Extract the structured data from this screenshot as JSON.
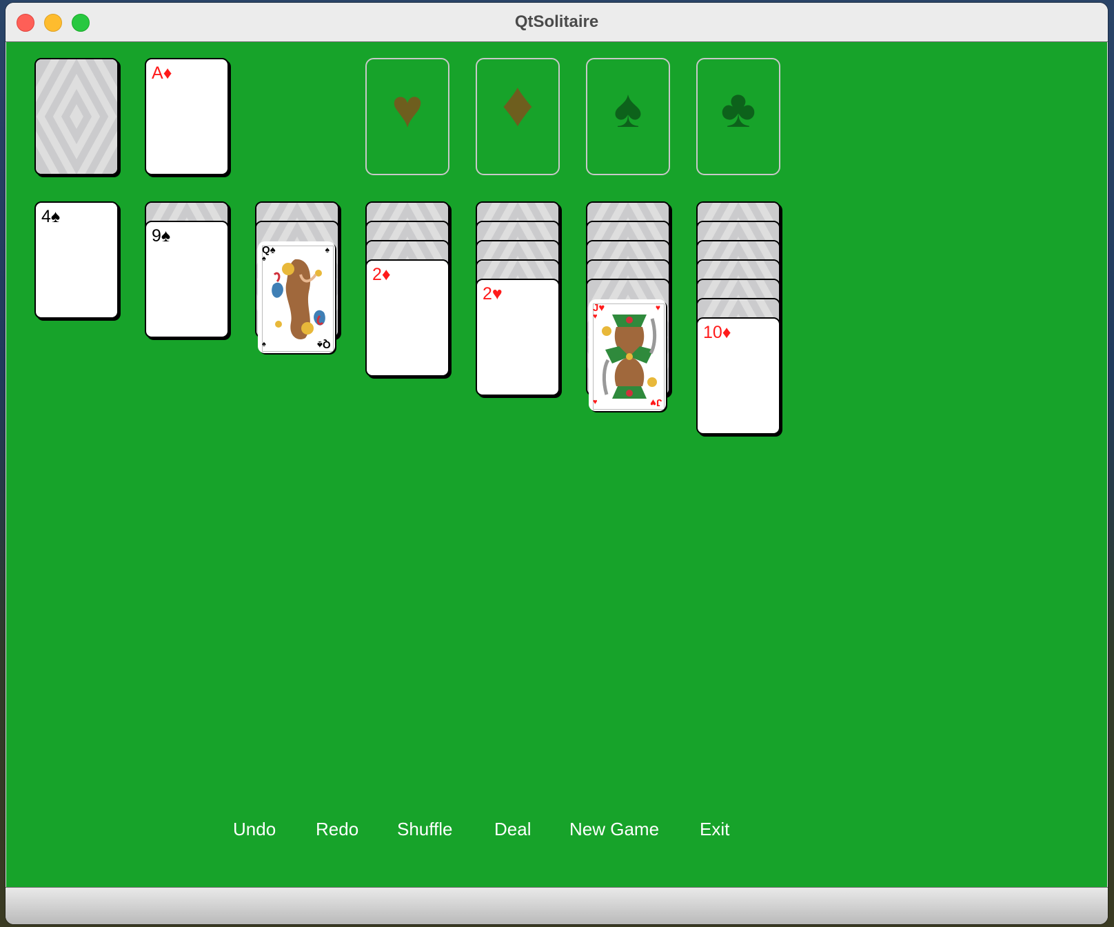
{
  "window": {
    "title": "QtSolitaire"
  },
  "colors": {
    "felt": "#17a32a",
    "red_suit": "#ff1a1a",
    "foundation_red_suit": "#6e5e1e",
    "foundation_black_suit": "#0d621b"
  },
  "stock": {
    "face_down": true
  },
  "waste": {
    "top_card": {
      "rank": "A",
      "suit": "♦",
      "color": "red"
    }
  },
  "foundations": [
    {
      "suit_name": "hearts",
      "symbol": "♥",
      "empty": true
    },
    {
      "suit_name": "diamonds",
      "symbol": "♦",
      "empty": true
    },
    {
      "suit_name": "spades",
      "symbol": "♠",
      "empty": true
    },
    {
      "suit_name": "clubs",
      "symbol": "♣",
      "empty": true
    }
  ],
  "tableau": [
    {
      "face_down": 0,
      "face_up": [
        {
          "rank": "4",
          "suit": "♠",
          "label": "4♠",
          "color": "black"
        }
      ]
    },
    {
      "face_down": 1,
      "face_up": [
        {
          "rank": "9",
          "suit": "♠",
          "label": "9♠",
          "color": "black"
        }
      ]
    },
    {
      "face_down": 2,
      "face_up": [
        {
          "rank": "Q",
          "suit": "♠",
          "label": "Q♠",
          "color": "black",
          "court": "queen"
        }
      ]
    },
    {
      "face_down": 3,
      "face_up": [
        {
          "rank": "2",
          "suit": "♦",
          "label": "2♦",
          "color": "red"
        }
      ]
    },
    {
      "face_down": 4,
      "face_up": [
        {
          "rank": "2",
          "suit": "♥",
          "label": "2♥",
          "color": "red"
        }
      ]
    },
    {
      "face_down": 5,
      "face_up": [
        {
          "rank": "J",
          "suit": "♥",
          "label": "J♥",
          "color": "red",
          "court": "jack"
        }
      ]
    },
    {
      "face_down": 6,
      "face_up": [
        {
          "rank": "10",
          "suit": "♦",
          "label": "10♦",
          "color": "red"
        }
      ]
    }
  ],
  "toolbar": {
    "undo": "Undo",
    "redo": "Redo",
    "shuffle": "Shuffle",
    "deal": "Deal",
    "new_game": "New Game",
    "exit": "Exit"
  },
  "icons": {
    "close": "close-icon",
    "minimize": "minimize-icon",
    "maximize": "maximize-icon"
  }
}
